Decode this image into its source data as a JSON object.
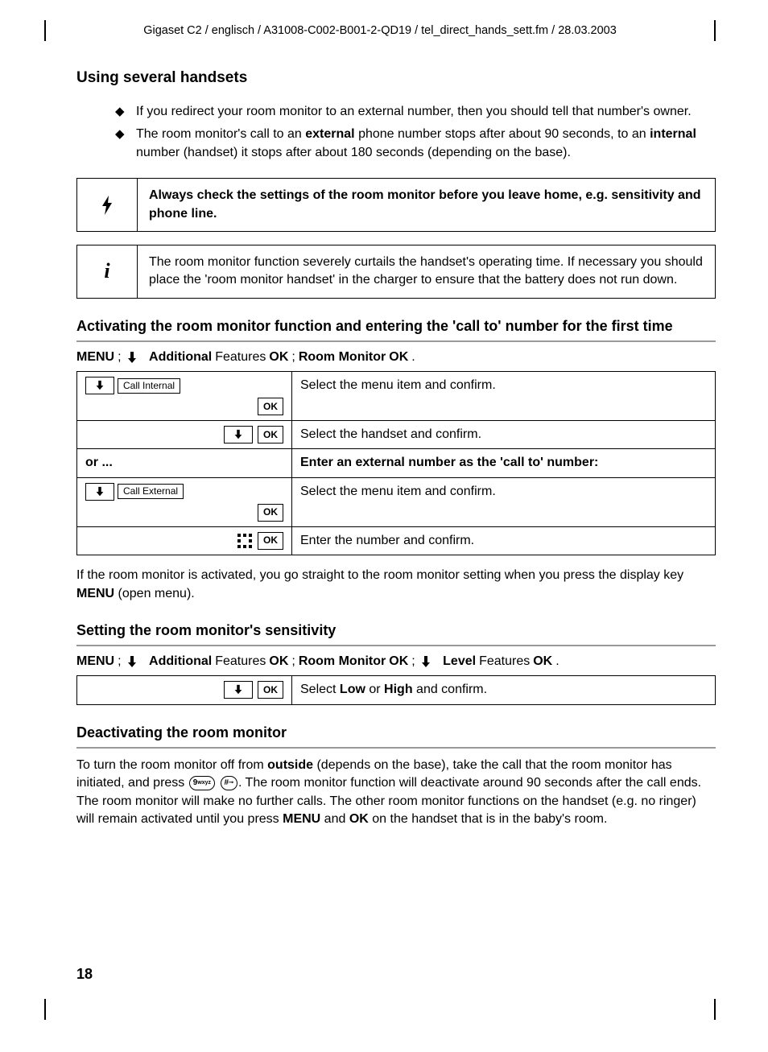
{
  "header": "Gigaset C2 / englisch / A31008-C002-B001-2-QD19 / tel_direct_hands_sett.fm / 28.03.2003",
  "h2": "Using several handsets",
  "bullets": [
    {
      "pre": "If you redirect your room monitor to an external number, then you should tell that number's owner."
    },
    {
      "pre": "The room monitor's call to an ",
      "b1": "external",
      "mid": " phone number stops after about 90 seconds, to an ",
      "b2": "internal",
      "post": " number (handset) it stops after about 180 seconds (depending on the base)."
    }
  ],
  "box1": "Always check the settings of the room monitor before you leave home, e.g. sensitivity and phone line.",
  "box2": "The room monitor function severely curtails the handset's operating time. If necessary you should place the 'room monitor handset' in the charger to ensure that the battery does not run down.",
  "h3a": "Activating the room monitor function and entering the 'call to' number for the first time",
  "nav1": {
    "menu": "MENU",
    "semi": "; ",
    "add": "Additional",
    "feat": " Features ",
    "ok": "OK",
    "rm": "Room Monitor ",
    "dot": "."
  },
  "t1": {
    "r1l_label": "Call Internal",
    "r1l_ok": "OK",
    "r1r": "Select the menu item and confirm.",
    "r2l_ok": "OK",
    "r2r": "Select the handset and confirm.",
    "r3l": "or ...",
    "r3r": "Enter an external number as the 'call to' number:",
    "r4l_label": "Call External",
    "r4l_ok": "OK",
    "r4r": "Select the menu item and confirm.",
    "r5l_ok": "OK",
    "r5r": "Enter the number and confirm."
  },
  "para1a": "If the room monitor is activated, you go straight to the room monitor setting when you press the display key ",
  "para1b": "MENU",
  "para1c": " (open menu).",
  "h3b": "Setting the room monitor's sensitivity",
  "nav2": {
    "level": "Level"
  },
  "t2": {
    "l_ok": "OK",
    "r_a": "Select ",
    "r_b": "Low",
    "r_c": " or ",
    "r_d": "High",
    "r_e": " and confirm."
  },
  "h3c": "Deactivating the room monitor",
  "para2": {
    "a": "To turn the room monitor off from ",
    "b": "outside",
    "c": " (depends on the base), take the call that the room monitor has initiated, and press ",
    "k1": "9",
    "k2": "#",
    "d": ". The room monitor function will deactivate around 90 seconds after the call ends. The room monitor will make no further calls. The other room monitor functions on the handset (e.g. no ringer) will remain activated until you press ",
    "e": "MENU",
    "f": " and ",
    "g": "OK",
    "h": " on the handset that is in the baby's room."
  },
  "pagenum": "18"
}
